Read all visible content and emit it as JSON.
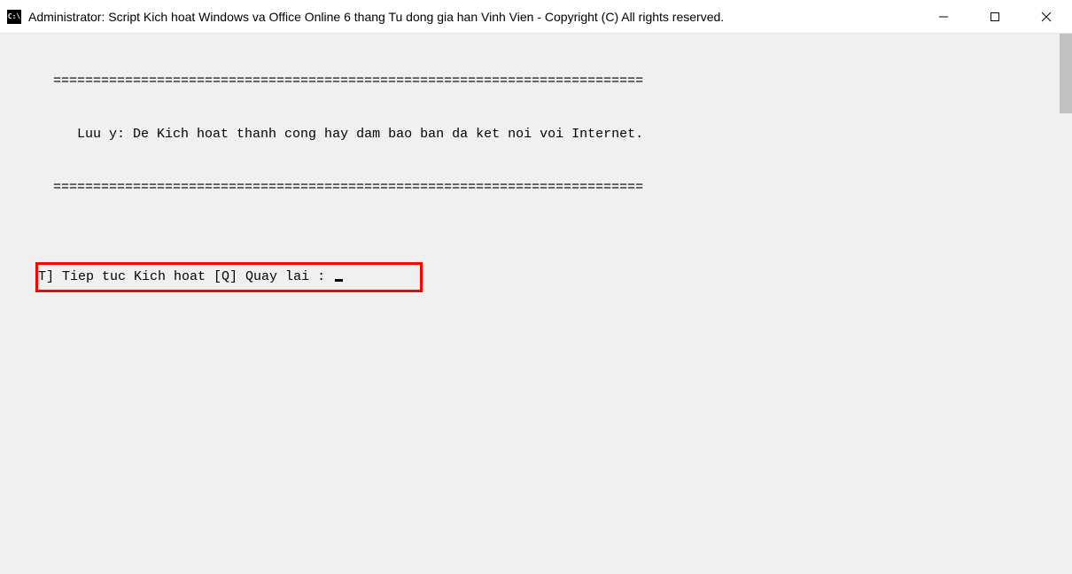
{
  "window": {
    "icon_text": "C:\\",
    "title": "Administrator:  Script Kich hoat Windows va Office Online 6 thang Tu dong gia han Vinh Vien - Copyright (C) All rights reserved."
  },
  "terminal": {
    "divider_top": "==========================================================================",
    "notice": "Luu y: De Kich hoat thanh cong hay dam bao ban da ket noi voi Internet.",
    "divider_bottom": "==========================================================================",
    "prompt_line": "T] Tiep tuc Kich hoat [Q] Quay lai : "
  }
}
